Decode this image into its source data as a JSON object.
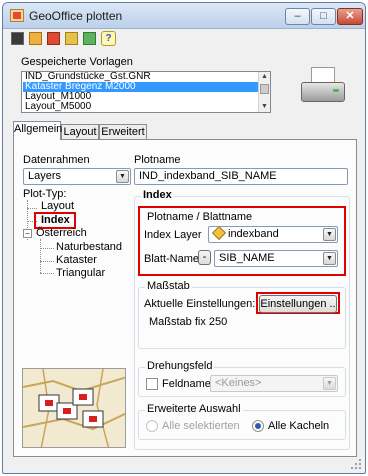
{
  "window": {
    "title": "GeoOffice plotten",
    "controls": {
      "minimize": "‒",
      "maximize": "□",
      "close": "✕"
    }
  },
  "toolbar": {
    "icons": [
      "save-icon",
      "delete-layout-icon",
      "print-layout-icon",
      "template-icon",
      "refresh-icon",
      "help-icon"
    ],
    "help_label": "?"
  },
  "templates": {
    "label": "Gespeicherte Vorlagen",
    "items": [
      "IND_Grundstücke_Gst.GNR",
      "Kataster Bregenz M2000",
      "Layout_M1000",
      "Layout_M5000"
    ],
    "selected_index": 1
  },
  "tabs": [
    "Allgemein",
    "Layout",
    "Erweitert"
  ],
  "active_tab": "Allgemein",
  "left": {
    "datenrahmen_label": "Datenrahmen",
    "datenrahmen_value": "Layers",
    "plot_typ_label": "Plot-Typ:",
    "tree": {
      "layout": "Layout",
      "index": "Index",
      "oesterreich": "Österreich",
      "naturbestand": "Naturbestand",
      "kataster": "Kataster",
      "triangular": "Triangular"
    }
  },
  "right": {
    "plotname_label": "Plotname",
    "plotname_value": "IND_indexband_SIB_NAME",
    "section_title": "Index",
    "plotname_group": {
      "title": "Plotname / Blattname",
      "index_layer_label": "Index Layer",
      "index_layer_value": "indexband",
      "blatt_name_label": "Blatt-Name",
      "blatt_name_minus": "-",
      "blatt_name_value": "SIB_NAME"
    },
    "massstab": {
      "title": "Maßstab",
      "current_label": "Aktuelle Einstellungen:",
      "settings_button": "Einstellungen ..",
      "scale_text": "Maßstab fix 250"
    },
    "drehungsfeld": {
      "title": "Drehungsfeld",
      "feldname_label": "Feldname",
      "feldname_value": "<Keines>"
    },
    "auswahl": {
      "title": "Erweiterte Auswahl",
      "option_all_selected": "Alle selektierten",
      "option_all_tiles": "Alle Kacheln",
      "selected": "Alle Kacheln"
    }
  },
  "colors": {
    "highlight_red": "#e00000",
    "list_selection": "#3399ff",
    "title_bar": "#bcd0ea"
  }
}
